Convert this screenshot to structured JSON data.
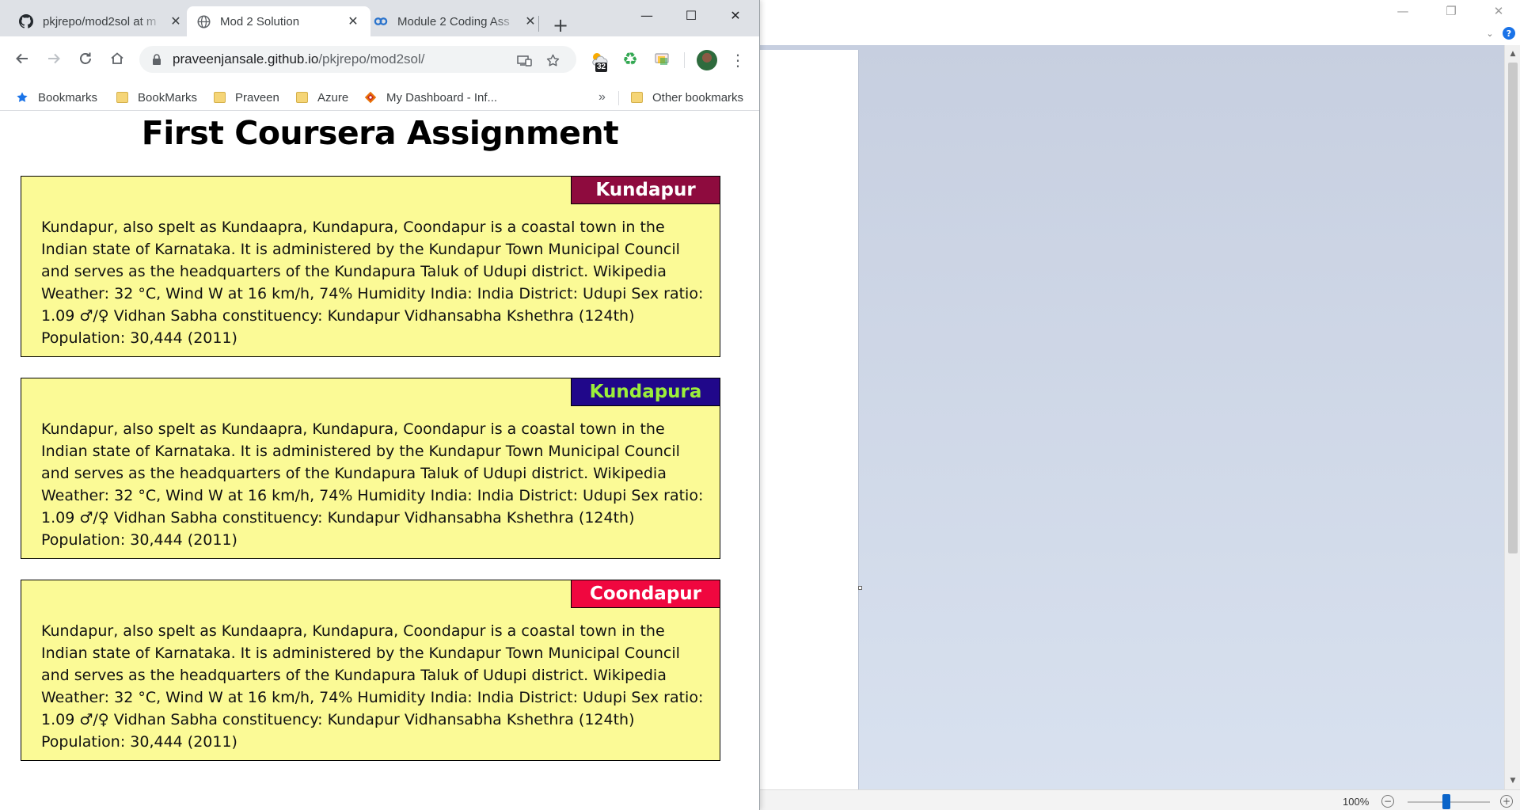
{
  "browser": {
    "tabs": [
      {
        "title": "pkjrepo/mod2sol at m",
        "icon": "github-icon",
        "active": false
      },
      {
        "title": "Mod 2 Solution",
        "icon": "globe-icon",
        "active": true
      },
      {
        "title": "Module 2 Coding Ass",
        "icon": "coursera-icon",
        "active": false
      }
    ],
    "new_tab_label": "+",
    "url_host": "praveenjansale.github.io",
    "url_path": "/pkjrepo/mod2sol/",
    "extension_badge": "32",
    "bookmarks": [
      {
        "label": "Bookmarks",
        "icon": "star-icon"
      },
      {
        "label": "BookMarks",
        "icon": "folder-icon"
      },
      {
        "label": "Praveen",
        "icon": "folder-icon"
      },
      {
        "label": "Azure",
        "icon": "folder-icon"
      },
      {
        "label": "My Dashboard - Inf...",
        "icon": "dashboard-icon"
      }
    ],
    "bookmarks_overflow": "»",
    "other_bookmarks": "Other bookmarks"
  },
  "page": {
    "title": "First Coursera Assignment",
    "sections": [
      {
        "label": "Kundapur",
        "label_bg": "#8e0b3e",
        "label_color": "#ffffff",
        "text": "Kundapur, also spelt as Kundaapra, Kundapura, Coondapur is a coastal town in the Indian state of Karnataka. It is administered by the Kundapur Town Municipal Council and serves as the headquarters of the Kundapura Taluk of Udupi district. Wikipedia Weather: 32 °C, Wind W at 16 km/h, 74% Humidity India: India District: Udupi Sex ratio: 1.09 ♂/♀ Vidhan Sabha constituency: Kundapur Vidhansabha Kshethra (124th) Population: 30,444 (2011)"
      },
      {
        "label": "Kundapura",
        "label_bg": "#20078a",
        "label_color": "#9bef3a",
        "text": "Kundapur, also spelt as Kundaapra, Kundapura, Coondapur is a coastal town in the Indian state of Karnataka. It is administered by the Kundapur Town Municipal Council and serves as the headquarters of the Kundapura Taluk of Udupi district. Wikipedia Weather: 32 °C, Wind W at 16 km/h, 74% Humidity India: India District: Udupi Sex ratio: 1.09 ♂/♀ Vidhan Sabha constituency: Kundapur Vidhansabha Kshethra (124th) Population: 30,444 (2011)"
      },
      {
        "label": "Coondapur",
        "label_bg": "#f0073f",
        "label_color": "#ffffff",
        "text": "Kundapur, also spelt as Kundaapra, Kundapura, Coondapur is a coastal town in the Indian state of Karnataka. It is administered by the Kundapur Town Municipal Council and serves as the headquarters of the Kundapura Taluk of Udupi district. Wikipedia Weather: 32 °C, Wind W at 16 km/h, 74% Humidity India: India District: Udupi Sex ratio: 1.09 ♂/♀ Vidhan Sabha constituency: Kundapur Vidhansabha Kshethra (124th) Population: 30,444 (2011)"
      }
    ],
    "card_bg": "#fbfa96"
  },
  "background_app": {
    "zoom_label": "100%"
  }
}
